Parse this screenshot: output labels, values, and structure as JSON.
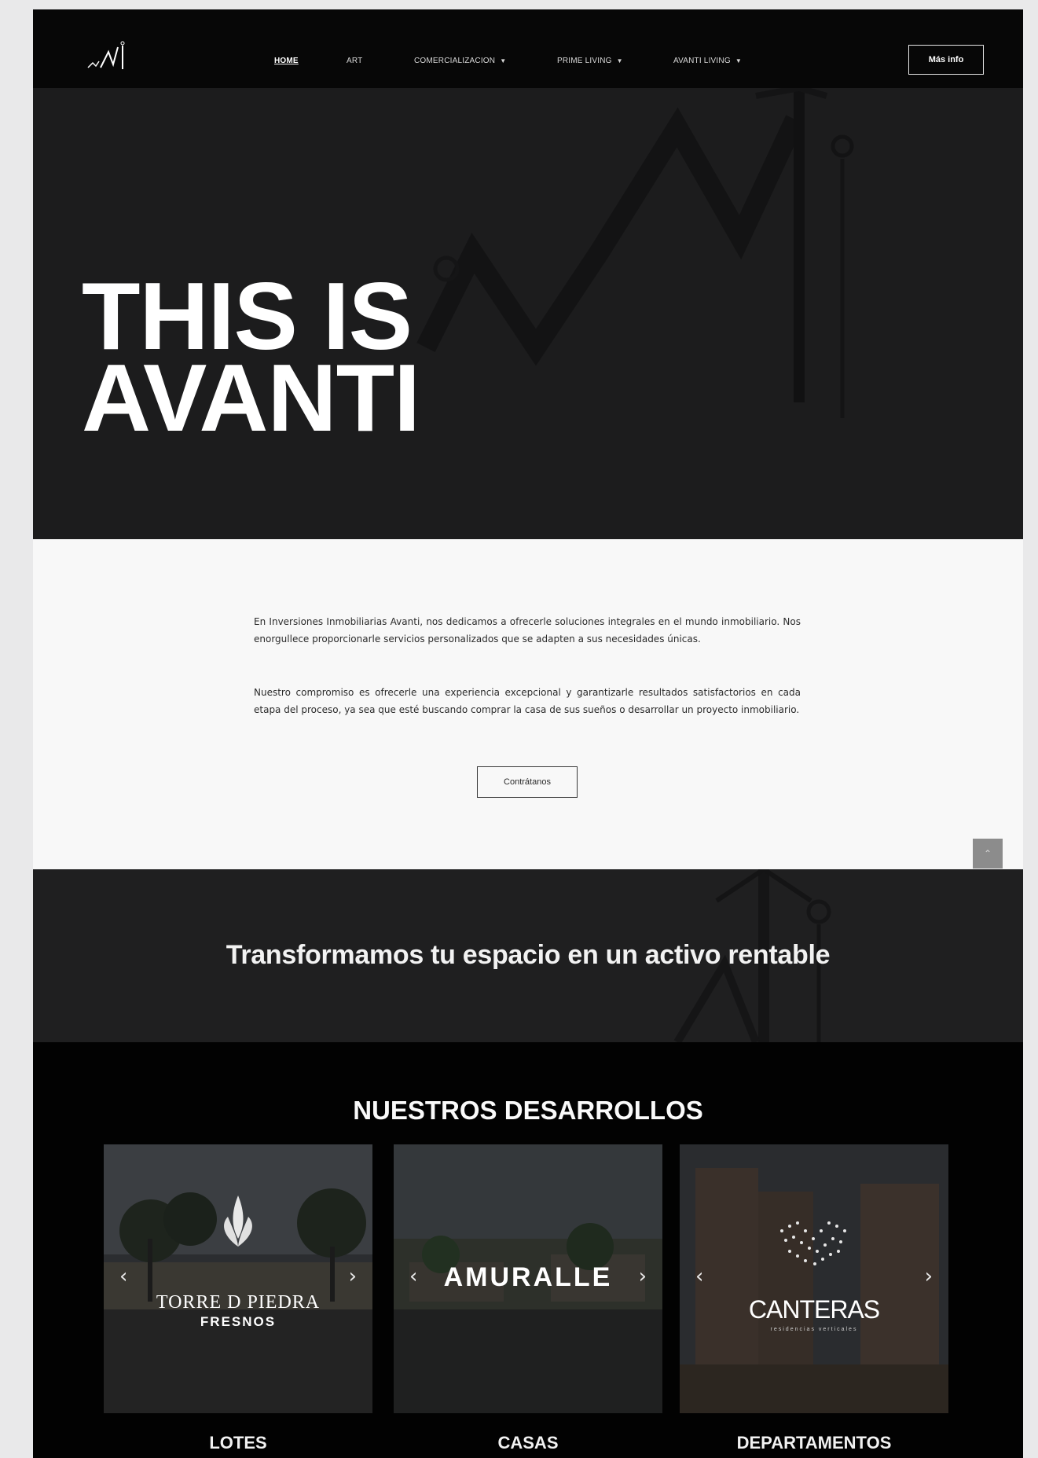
{
  "nav": {
    "items": [
      {
        "label": "HOME",
        "active": true
      },
      {
        "label": "ART",
        "active": false
      },
      {
        "label": "COMERCIALIZACION",
        "active": false
      },
      {
        "label": "PRIME LIVING",
        "active": false
      },
      {
        "label": "AVANTI LIVING",
        "active": false
      }
    ],
    "more_label": "Más info"
  },
  "hero": {
    "line1": "THIS IS",
    "line2": "AVANTI"
  },
  "about": {
    "paragraph1": "En Inversiones Inmobiliarias Avanti, nos dedicamos a ofrecerle soluciones integrales en el mundo inmobiliario. Nos enorgullece proporcionarle servicios personalizados que se adapten a sus necesidades únicas.",
    "paragraph2": "Nuestro compromiso es ofrecerle una experiencia excepcional y garantizarle resultados satisfactorios en cada etapa del proceso, ya sea que esté buscando comprar la casa de sus sueños o desarrollar un proyecto inmobiliario.",
    "cta_label": "Contrátanos"
  },
  "banner": {
    "headline": "Transformamos tu espacio en un activo rentable"
  },
  "developments": {
    "title": "NUESTROS DESARROLLOS",
    "cards": [
      {
        "brand_line1": "TORRE D PIEDRA",
        "brand_line2": "FRESNOS",
        "label": "LOTES"
      },
      {
        "brand_line1": "AMURALLE",
        "label": "CASAS"
      },
      {
        "brand_line1": "CANTERAS",
        "brand_line2": "residencias verticales",
        "label": "DEPARTAMENTOS"
      }
    ]
  },
  "colors": {
    "nav_bg": "#070707",
    "hero_bg": "#1c1c1d",
    "about_bg": "#f8f8f8",
    "banner_bg": "#1f1f20",
    "devs_bg": "#020202"
  }
}
